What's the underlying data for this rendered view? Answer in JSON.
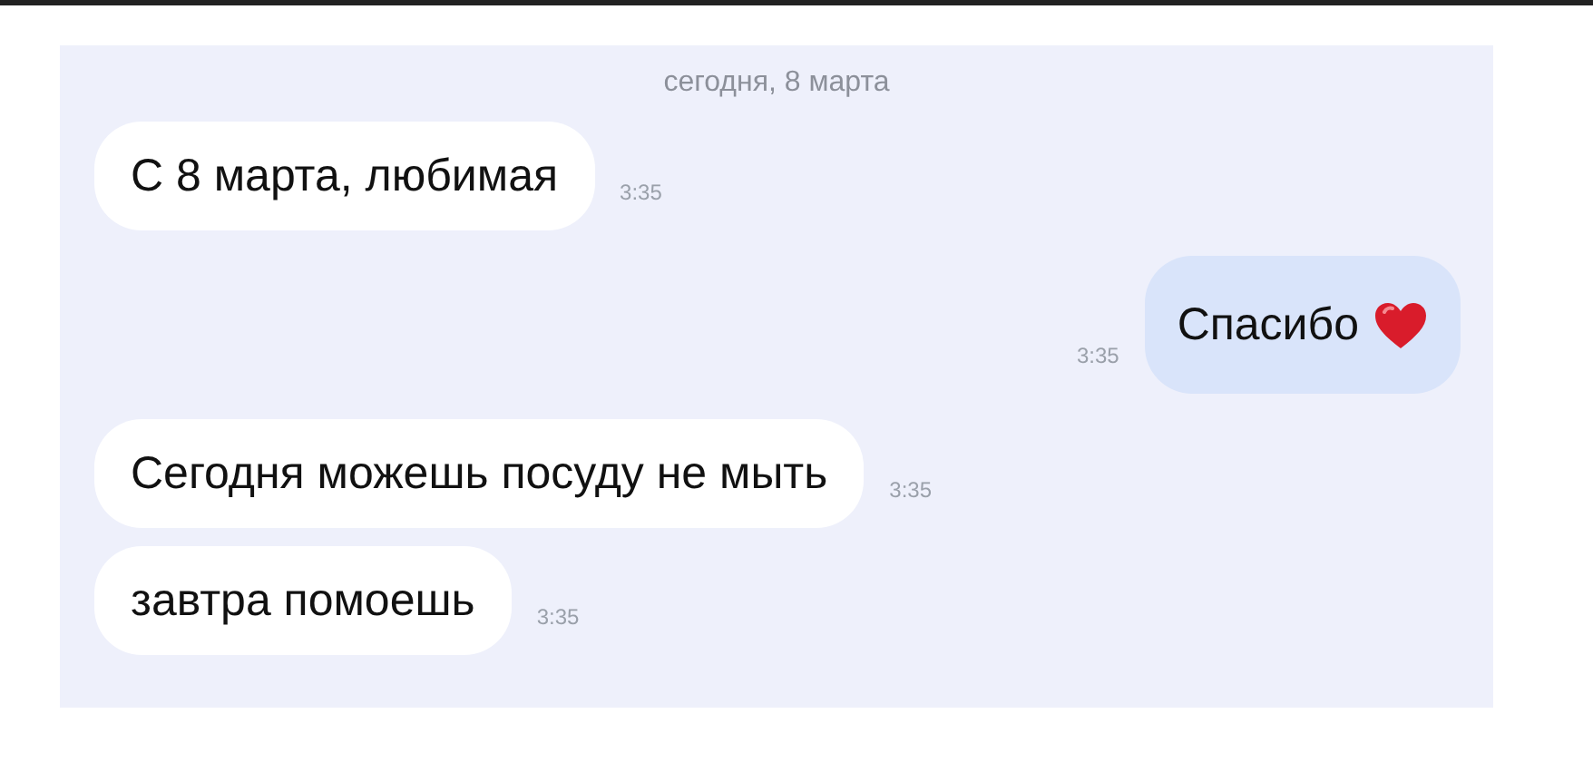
{
  "chat": {
    "date": "сегодня, 8 марта",
    "messages": [
      {
        "kind": "in",
        "text": "С 8 марта, любимая",
        "time": "3:35",
        "heart": false
      },
      {
        "kind": "out",
        "text": "Спасибо",
        "time": "3:35",
        "heart": true
      },
      {
        "kind": "in",
        "text": "Сегодня можешь посуду не мыть",
        "time": "3:35",
        "heart": false
      },
      {
        "kind": "in",
        "text": "завтра помоешь",
        "time": "3:35",
        "heart": false
      }
    ]
  }
}
